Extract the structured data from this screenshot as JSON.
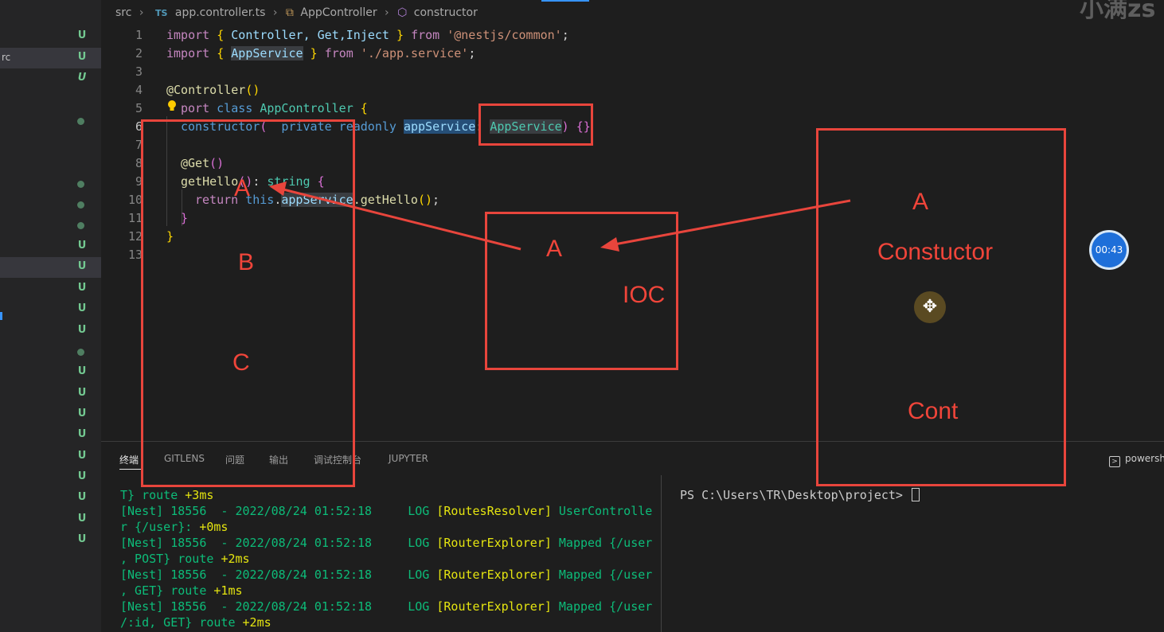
{
  "breadcrumb": {
    "folder": "src",
    "lang_badge": "TS",
    "file": "app.controller.ts",
    "class_name": "AppController",
    "member": "constructor"
  },
  "watermark": "小满zs",
  "explorer": {
    "visible_text": "rc",
    "rows": [
      {
        "badge": "U"
      },
      {
        "badge": "U"
      },
      {
        "badge": "U"
      },
      {
        "badge": "●"
      },
      {
        "badge": "●"
      },
      {
        "badge": "●"
      },
      {
        "badge": "●"
      },
      {
        "badge": "U"
      },
      {
        "badge": "U"
      },
      {
        "badge": "U"
      },
      {
        "badge": "U"
      },
      {
        "badge": "U"
      },
      {
        "badge": "●"
      },
      {
        "badge": "U"
      },
      {
        "badge": "U"
      },
      {
        "badge": "U"
      },
      {
        "badge": "U"
      },
      {
        "badge": "U"
      },
      {
        "badge": "U"
      },
      {
        "badge": "U"
      },
      {
        "badge": "U"
      },
      {
        "badge": "U"
      }
    ]
  },
  "editor": {
    "line_numbers": [
      "1",
      "2",
      "3",
      "4",
      "5",
      "6",
      "7",
      "8",
      "9",
      "10",
      "11",
      "12",
      "13"
    ],
    "active_line": "6",
    "code": {
      "l1": {
        "kw": "import",
        "b1": "{",
        "ids": " Controller, Get,Inject ",
        "b2": "}",
        "from": "from",
        "str": "'@nestjs/common'",
        "end": ";"
      },
      "l2": {
        "kw": "import",
        "b1": "{",
        "id": "AppService",
        "b2": "}",
        "from": "from",
        "str": "'./app.service'",
        "end": ";"
      },
      "l4": {
        "deco": "@Controller",
        "paren": "()"
      },
      "l5": {
        "kw": "port",
        "kw2": "class",
        "cls": "AppController",
        "brace": "{"
      },
      "l6": {
        "ctor": "constructor",
        "paren": "(",
        "mods": "  private readonly ",
        "param": "appService",
        "colon": ": ",
        "type": "AppService",
        "close": ")",
        "braces": "{}"
      },
      "l8": {
        "deco": "@Get",
        "paren": "()"
      },
      "l9": {
        "fn": "getHello",
        "paren": "()",
        "colon": ": ",
        "type": "string",
        "brace": "{"
      },
      "l10": {
        "kw": "return",
        "this": "this",
        "dot": ".",
        "member": "appService",
        "call": ".getHello",
        "paren": "()",
        "end": ";"
      },
      "l11": {
        "brace": "}"
      },
      "l12": {
        "brace": "}"
      }
    }
  },
  "panel": {
    "tabs": [
      "终端",
      "GITLENS",
      "问题",
      "输出",
      "调试控制台",
      "JUPYTER"
    ],
    "shell_tab": "powersh",
    "log_lines": [
      {
        "pre": "T} route ",
        "ms": "+3ms"
      },
      {
        "nest": "[Nest] 18556  - 2022/08/24 01:52:18     LOG ",
        "ctx": "[RoutesResolver]",
        "msg": " UserControlle"
      },
      {
        "pre": "r {/user}: ",
        "ms": "+0ms"
      },
      {
        "nest": "[Nest] 18556  - 2022/08/24 01:52:18     LOG ",
        "ctx": "[RouterExplorer]",
        "msg": " Mapped {/user"
      },
      {
        "pre": ", POST} route ",
        "ms": "+2ms"
      },
      {
        "nest": "[Nest] 18556  - 2022/08/24 01:52:18     LOG ",
        "ctx": "[RouterExplorer]",
        "msg": " Mapped {/user"
      },
      {
        "pre": ", GET} route ",
        "ms": "+1ms"
      },
      {
        "nest": "[Nest] 18556  - 2022/08/24 01:52:18     LOG ",
        "ctx": "[RouterExplorer]",
        "msg": " Mapped {/user"
      },
      {
        "pre": "/:id, GET} route ",
        "ms": "+2ms"
      }
    ],
    "prompt": "PS C:\\Users\\TR\\Desktop\\project> "
  },
  "annotations": {
    "left_box": {
      "a": "A",
      "b": "B",
      "c": "C"
    },
    "ioc_box": {
      "a": "A",
      "label": "IOC"
    },
    "right_box": {
      "a": "A",
      "ctor": "Constuctor",
      "cont": "Cont"
    }
  },
  "timer": "00:43",
  "colors": {
    "annotation_red": "#e8453c",
    "git_untracked": "#73c991",
    "timer_blue": "#1e6fd9"
  }
}
